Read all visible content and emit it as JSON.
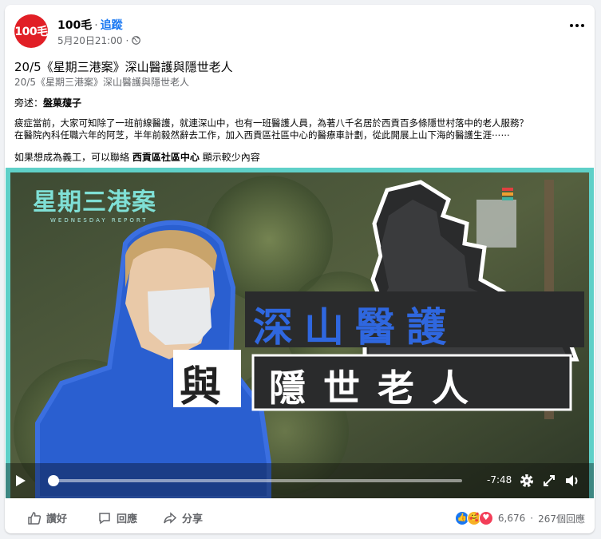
{
  "header": {
    "avatar_text": "100毛",
    "page_name": "100毛",
    "separator": "·",
    "follow_label": "追蹤",
    "timestamp": "5月20日21:00",
    "timestamp_sep": "·"
  },
  "post": {
    "title": "20/5《星期三港案》深山醫護與隱世老人",
    "subtitle": "20/5《星期三港案》深山醫護與隱世老人",
    "narrator_label": "旁述：",
    "narrator_name": "盤菓蕿子",
    "body_line1": "疲症當前，大家可知除了一班前線醫護，就連深山中，也有一班醫護人員，為著八千名居於西貢百多條隱世村落中的老人服務？",
    "body_line2": "在醫院內科任職六年的阿芝，半年前毅然辭去工作，加入西貢區社區中心的醫療車計劃，從此開展上山下海的醫護生涯⋯⋯",
    "volunteer_prefix": "如果想成為義工，可以聯絡",
    "volunteer_org": "西貢區社區中心",
    "volunteer_more": "顯示較少內容"
  },
  "video": {
    "logo_main": "星期三港案",
    "logo_sub": "WEDNESDAY REPORT",
    "headline1": "深山醫護",
    "headline_and": "與",
    "headline2": "隱世老人",
    "time_remaining": "-7:48",
    "progress": 0.0,
    "colors": {
      "accent_teal": "#5fd0c8",
      "headline_blue": "#2a5fd0",
      "outline_blue": "#3b6fe0"
    }
  },
  "footer": {
    "like_label": "讚好",
    "comment_label": "回應",
    "share_label": "分享",
    "reaction_count": "6,676",
    "separator": "·",
    "comment_count": "267個回應"
  }
}
